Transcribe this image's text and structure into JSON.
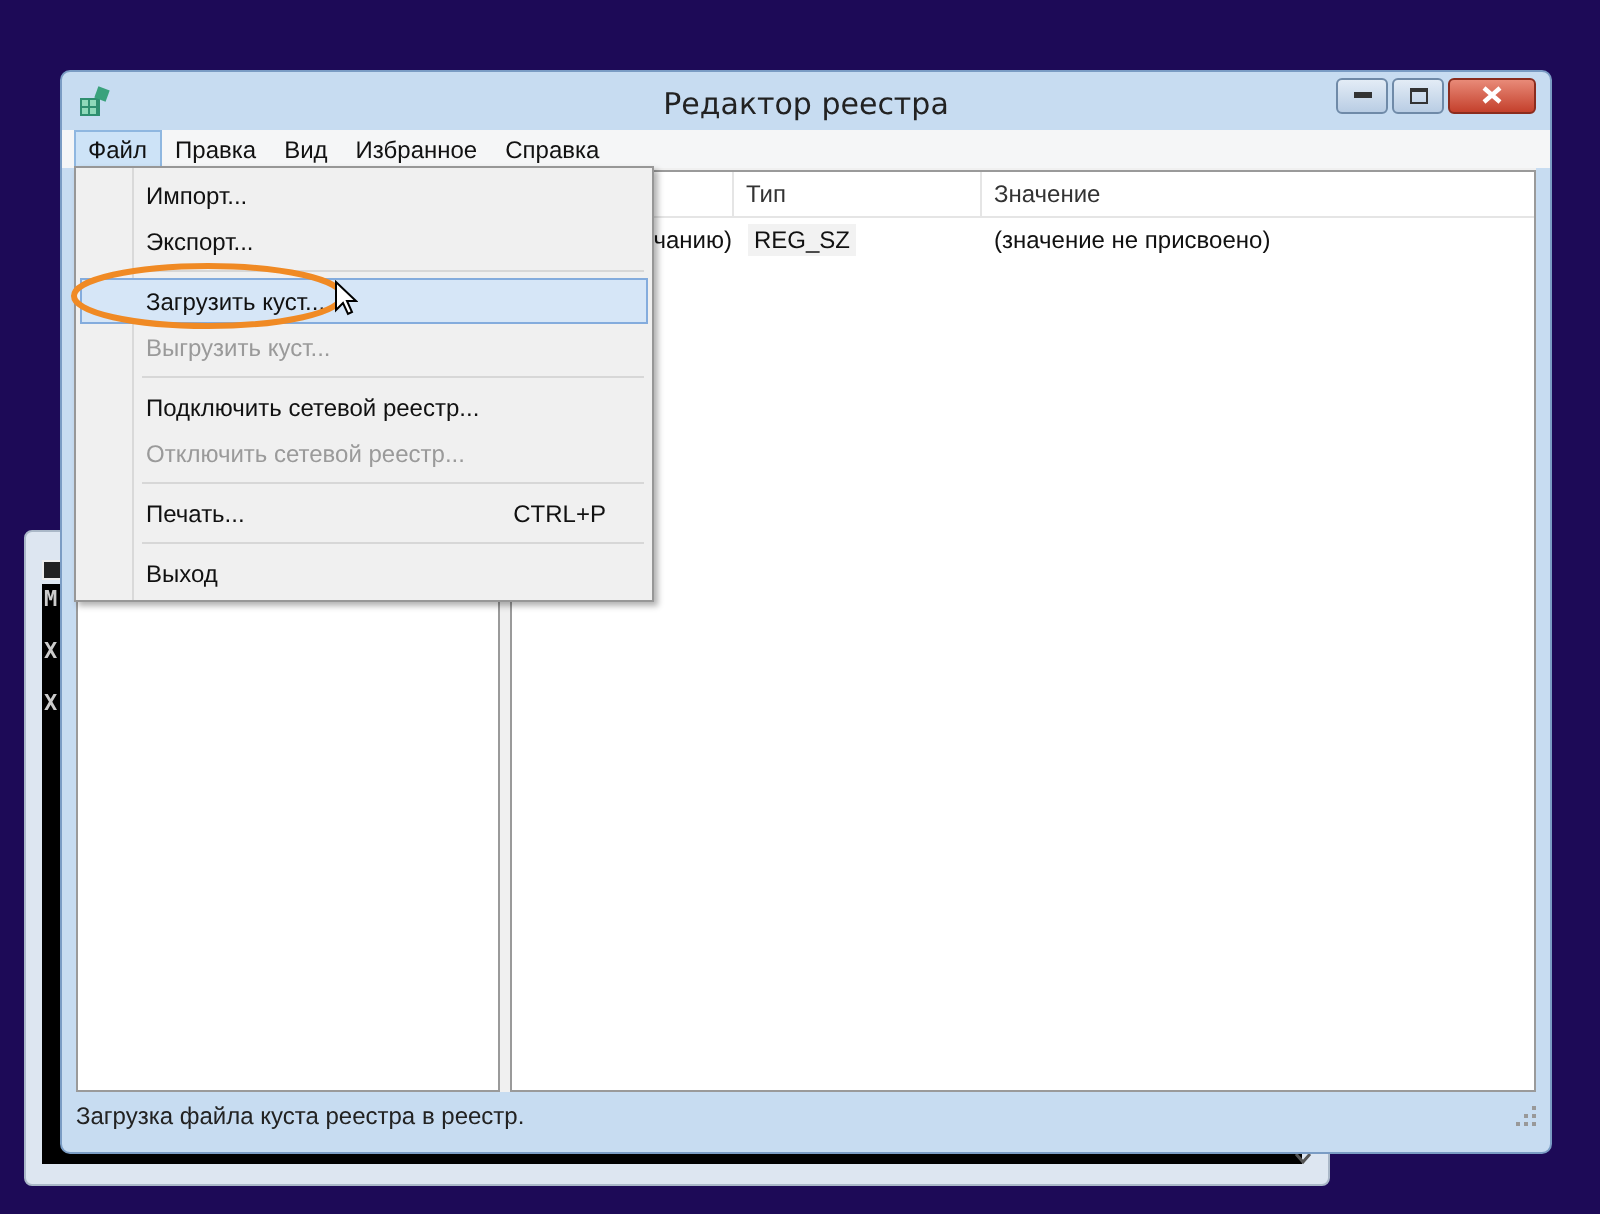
{
  "console_window": {
    "lines": [
      "M",
      "X",
      "X"
    ]
  },
  "window": {
    "title": "Редактор реестра"
  },
  "menu_bar": [
    {
      "label": "Файл",
      "selected": true
    },
    {
      "label": "Правка",
      "selected": false
    },
    {
      "label": "Вид",
      "selected": false
    },
    {
      "label": "Избранное",
      "selected": false
    },
    {
      "label": "Справка",
      "selected": false
    }
  ],
  "file_menu": [
    {
      "kind": "item",
      "label": "Импорт...",
      "disabled": false,
      "selected": false
    },
    {
      "kind": "item",
      "label": "Экспорт...",
      "disabled": false,
      "selected": false
    },
    {
      "kind": "separator"
    },
    {
      "kind": "item",
      "label": "Загрузить куст...",
      "disabled": false,
      "selected": true
    },
    {
      "kind": "item",
      "label": "Выгрузить куст...",
      "disabled": true,
      "selected": false
    },
    {
      "kind": "separator"
    },
    {
      "kind": "item",
      "label": "Подключить сетевой реестр...",
      "disabled": false,
      "selected": false
    },
    {
      "kind": "item",
      "label": "Отключить сетевой реестр...",
      "disabled": true,
      "selected": false
    },
    {
      "kind": "separator"
    },
    {
      "kind": "item",
      "label": "Печать...",
      "shortcut": "CTRL+P",
      "disabled": false,
      "selected": false
    },
    {
      "kind": "separator"
    },
    {
      "kind": "item",
      "label": "Выход",
      "disabled": false,
      "selected": false
    }
  ],
  "table": {
    "columns": [
      "Тип",
      "Значение"
    ],
    "rows": [
      {
        "column_1": "чанию)",
        "type": "REG_SZ",
        "value": "(значение не присвоено)"
      }
    ]
  },
  "status_bar": "Загрузка файла куста реестра в реестр."
}
